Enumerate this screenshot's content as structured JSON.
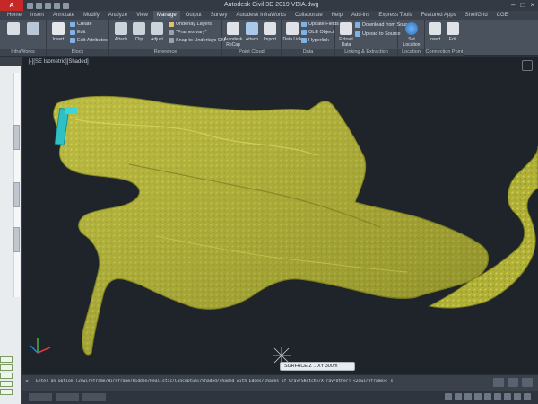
{
  "app": {
    "logo_label": "A",
    "title": "Autodesk Civil 3D 2019   VBIA.dwg"
  },
  "tabs": [
    "Home",
    "Insert",
    "Annotate",
    "Modify",
    "Analyze",
    "View",
    "Manage",
    "Output",
    "Survey",
    "Autodesk InfraWorks",
    "Collaborate",
    "Help",
    "Add-ins",
    "Express Tools",
    "Featured Apps",
    "ShelfGrid",
    "CGE"
  ],
  "ribbon": {
    "panels": [
      {
        "title": "InfraWorks"
      },
      {
        "title": "Block"
      },
      {
        "title": "Reference"
      },
      {
        "title": "Point Cloud"
      },
      {
        "title": "Data"
      },
      {
        "title": "Linking & Extraction"
      },
      {
        "title": "Location"
      },
      {
        "title": "Connection Point"
      }
    ],
    "buttons": {
      "insert": "Insert",
      "create": "Create",
      "edit": "Edit",
      "edit_attributes": "Edit Attributes",
      "attach": "Attach",
      "clip": "Clip",
      "adjust": "Adjust",
      "underlay_layers": "Underlay Layers",
      "frames_vary": "*Frames vary*",
      "snap_to_underlays": "Snap to Underlays ON",
      "autodesk_recap": "Autodesk ReCap",
      "attach_pc": "Attach",
      "import": "Import",
      "data_link": "Data Link",
      "update_fields": "Update Fields",
      "ole_object": "OLE Object",
      "hyperlink": "Hyperlink",
      "extract_data": "Extract Data",
      "download_from_source": "Download from Source",
      "upload_to_source": "Upload to Source",
      "set_location": "Set Location",
      "insert_cp": "Insert",
      "edit_cp": "Edit"
    }
  },
  "viewport": {
    "label": "[-][SE Isometric][Shaded]",
    "coord_label": "SURFACE  Z  .. XY 300m"
  },
  "command_line": {
    "text": "Enter an option [2dwireframe/Wireframe/Hidden/Realistic/Conceptual/Shaded/shaded with Edges/shades of Gray/SKetchy/X-ray/Other] <2dwireframe>: s"
  },
  "colors": {
    "terrain": "#b5b53a",
    "terrain_dark": "#7b7d1f",
    "viewport_bg": "#1f232a",
    "ribbon_bg": "#4a525e",
    "accent_red": "#c62828"
  }
}
